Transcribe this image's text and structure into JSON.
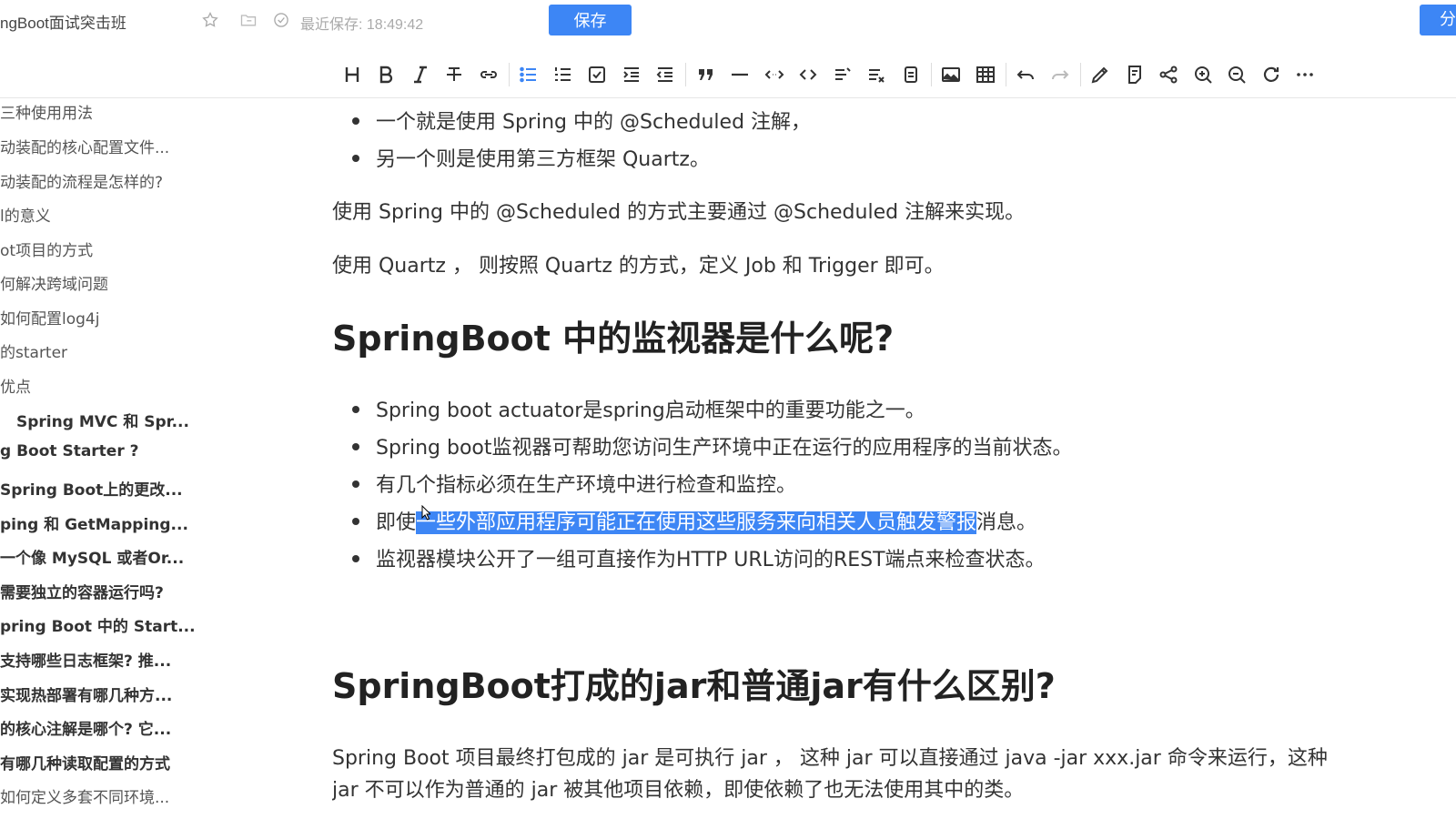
{
  "app": {
    "doc_title": "ngBoot面试突击班",
    "save_status": "最近保存: 18:49:42",
    "save_label": "保存",
    "share_label": "分",
    "accent_color": "#3d86f5"
  },
  "toolbar": {
    "icons": [
      "heading-icon",
      "bold-icon",
      "italic-icon",
      "strikethrough-icon",
      "link-icon",
      "bullet-list-icon",
      "numbered-list-icon",
      "checkbox-icon",
      "indent-icon",
      "outdent-icon",
      "quote-icon",
      "hr-icon",
      "inline-code-icon",
      "code-block-icon",
      "toc-icon",
      "formula-icon",
      "attachment-icon",
      "image-icon",
      "table-icon",
      "undo-icon",
      "redo-icon",
      "pen-icon",
      "note-icon",
      "share-icon",
      "zoom-in-icon",
      "zoom-out-icon",
      "refresh-icon",
      "more-icon"
    ]
  },
  "outline": {
    "items": [
      {
        "label": "三种使用用法"
      },
      {
        "label": "动装配的核心配置文件..."
      },
      {
        "label": "动装配的流程是怎样的?"
      },
      {
        "label": "l的意义"
      },
      {
        "label": "ot项目的方式"
      },
      {
        "label": "何解决跨域问题"
      },
      {
        "label": "如何配置log4j"
      },
      {
        "label": "的starter"
      },
      {
        "label": "优点"
      },
      {
        "label": "Spring MVC 和 Spr..."
      },
      {
        "label": "g Boot Starter ?"
      },
      {
        "label": "Spring Boot上的更改..."
      },
      {
        "label": "ping 和 GetMapping..."
      },
      {
        "label": "一个像 MySQL 或者Or..."
      },
      {
        "label": "需要独立的容器运行吗?"
      },
      {
        "label": "pring Boot 中的 Start..."
      },
      {
        "label": "支持哪些日志框架? 推..."
      },
      {
        "label": "实现热部署有哪几种方..."
      },
      {
        "label": "的核心注解是哪个? 它..."
      },
      {
        "label": "有哪几种读取配置的方式"
      },
      {
        "label": "如何定义多套不同环境..."
      }
    ]
  },
  "content": {
    "list1": [
      "一个就是使用 Spring 中的 @Scheduled 注解，",
      "另一个则是使用第三方框架 Quartz。"
    ],
    "para1": "使用 Spring 中的 @Scheduled 的方式主要通过 @Scheduled 注解来实现。",
    "para2": "使用 Quartz ， 则按照 Quartz 的方式，定义 Job 和 Trigger 即可。",
    "h1_tag": "H1",
    "heading1": "SpringBoot 中的监视器是什么呢?",
    "list2": [
      "Spring boot actuator是spring启动框架中的重要功能之一。",
      "Spring boot监视器可帮助您访问生产环境中正在运行的应用程序的当前状态。",
      "有几个指标必须在生产环境中进行检查和监控。"
    ],
    "list2_item4_pre": "即使",
    "list2_item4_sel": "一些外部应用程序可能正在使用这些服务来向相关人员触发警报",
    "list2_item4_post": "消息。",
    "list2_item5": "监视器模块公开了一组可直接作为HTTP URL访问的REST端点来检查状态。",
    "heading2": "SpringBoot打成的jar和普通jar有什么区别?",
    "para3_line1": "Spring Boot 项目最终打包成的 jar 是可执行 jar ， 这种 jar 可以直接通过 java -jar xxx.jar 命令来运行，这种",
    "para3_line2": "jar 不可以作为普通的 jar 被其他项目依赖，即使依赖了也无法使用其中的类。"
  }
}
